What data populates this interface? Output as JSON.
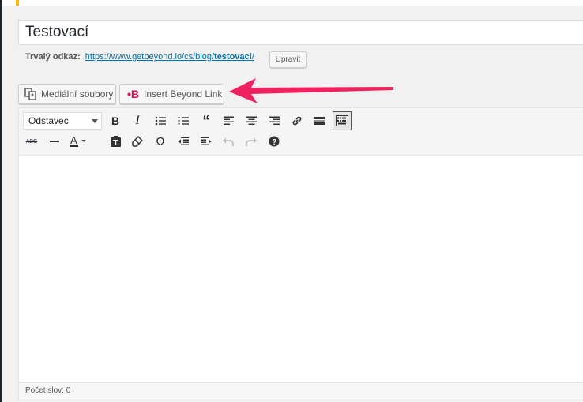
{
  "post": {
    "title": "Testovací",
    "permalink_label": "Trvalý odkaz:",
    "permalink_base": "https://www.getbeyond.io/cs/blog/",
    "permalink_slug": "testovaci",
    "permalink_trailing": "/",
    "edit_permalink_label": "Upravit"
  },
  "media_buttons": {
    "media_label": "Mediální soubory",
    "beyond_label": "Insert Beyond Link"
  },
  "toolbar": {
    "format_value": "Odstavec",
    "items_row1": [
      "bold-icon",
      "italic-icon",
      "bullet-list-icon",
      "numbered-list-icon",
      "blockquote-icon",
      "align-left-icon",
      "align-center-icon",
      "align-right-icon",
      "link-icon",
      "read-more-icon",
      "toolbar-toggle-icon"
    ],
    "items_row2": [
      "strikethrough-icon",
      "horizontal-line-icon",
      "text-color-icon",
      "paste-as-text-icon",
      "clear-formatting-icon",
      "special-character-icon",
      "outdent-icon",
      "indent-icon",
      "undo-icon",
      "redo-icon",
      "help-icon"
    ]
  },
  "status": {
    "word_count": "Počet slov: 0"
  },
  "colors": {
    "arrow": "#f0215f",
    "beyond_brand": "#d4145a",
    "link": "#0073aa"
  }
}
